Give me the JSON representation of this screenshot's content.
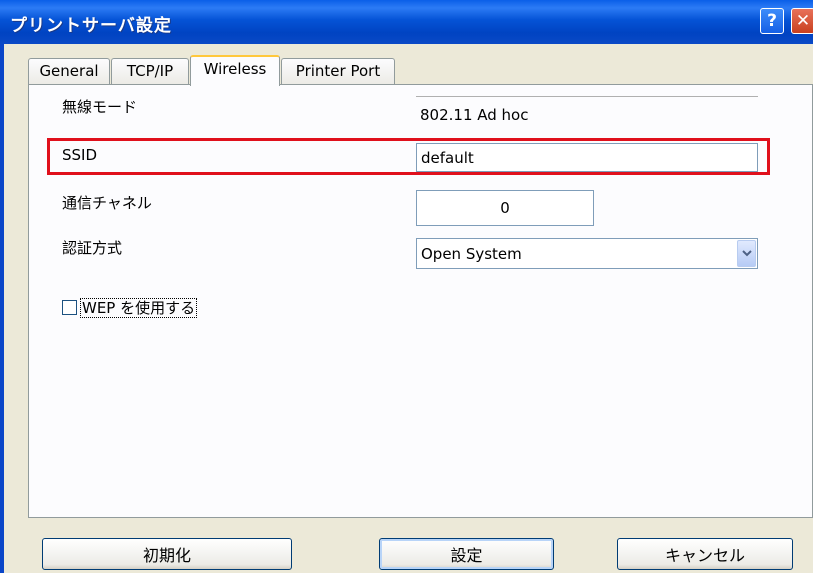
{
  "window": {
    "title": "プリントサーバ設定",
    "help_label": "?",
    "close_label": "✕"
  },
  "tabs": [
    {
      "label": "General",
      "active": false
    },
    {
      "label": "TCP/IP",
      "active": false
    },
    {
      "label": "Wireless",
      "active": true
    },
    {
      "label": "Printer Port",
      "active": false
    }
  ],
  "form": {
    "mode_label": "無線モード",
    "mode_value": "802.11 Ad hoc",
    "ssid_label": "SSID",
    "ssid_value": "default",
    "channel_label": "通信チャネル",
    "channel_value": "0",
    "auth_label": "認証方式",
    "auth_value": "Open System",
    "wep_label": "WEP を使用する",
    "wep_checked": false
  },
  "buttons": {
    "init_label": "初期化",
    "apply_label": "設定",
    "cancel_label": "キャンセル"
  },
  "colors": {
    "highlight": "#E0101C",
    "titlebar": "#0553D6"
  }
}
